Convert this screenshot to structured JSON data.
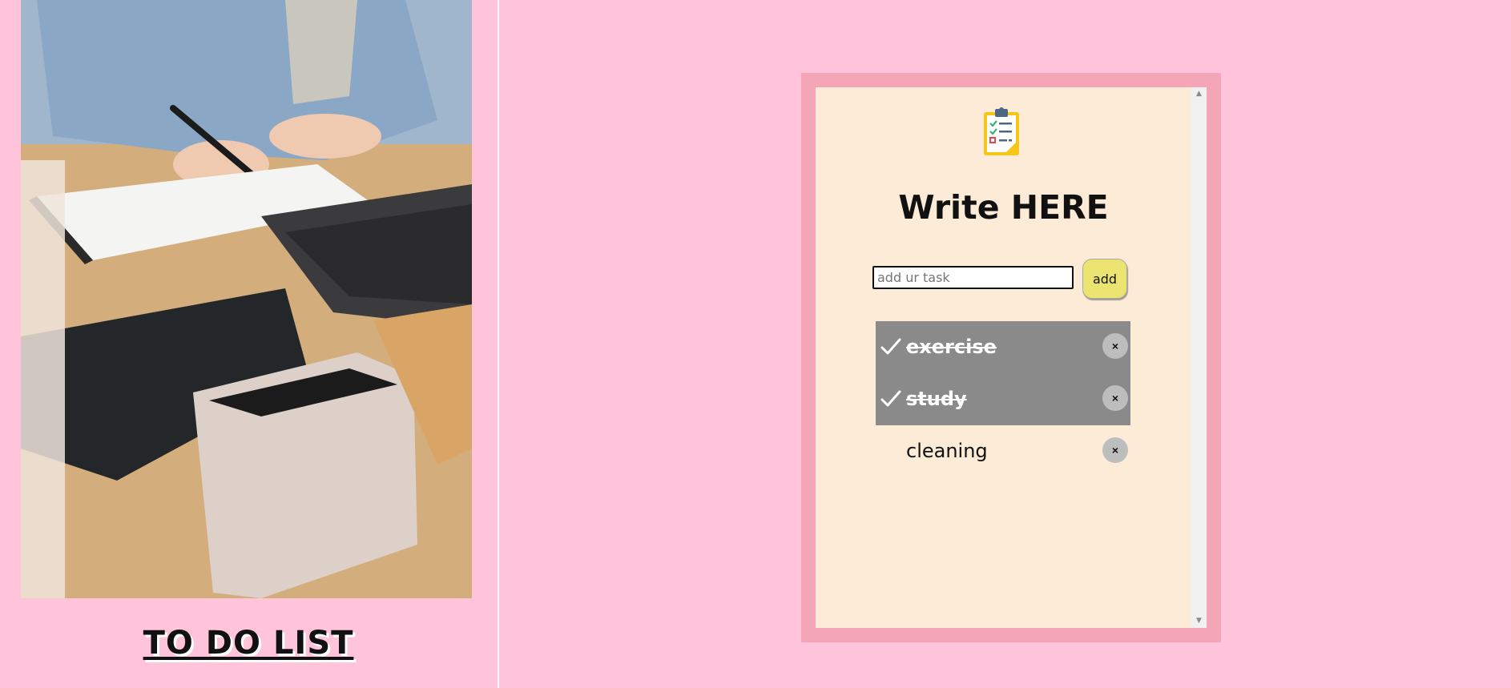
{
  "page": {
    "heading": "TO DO LIST"
  },
  "app": {
    "title": "Write HERE",
    "input": {
      "placeholder": "add ur task",
      "value": ""
    },
    "add_label": "add",
    "tasks": [
      {
        "text": "exercise",
        "done": true,
        "remove_label": "×"
      },
      {
        "text": "study",
        "done": true,
        "remove_label": "×"
      },
      {
        "text": "cleaning",
        "done": false,
        "remove_label": "×"
      }
    ],
    "scroll_up": "▲",
    "scroll_down": "▼"
  },
  "icons": {
    "logo": "clipboard-checklist-icon",
    "done": "check-icon",
    "remove": "close-icon"
  },
  "colors": {
    "background": "#ffc4da",
    "frame": "#f4a6b8",
    "card": "#fbebd7",
    "add_button": "#ece470",
    "done_row": "#8a8a8a",
    "remove_button": "#bdbdbd"
  }
}
